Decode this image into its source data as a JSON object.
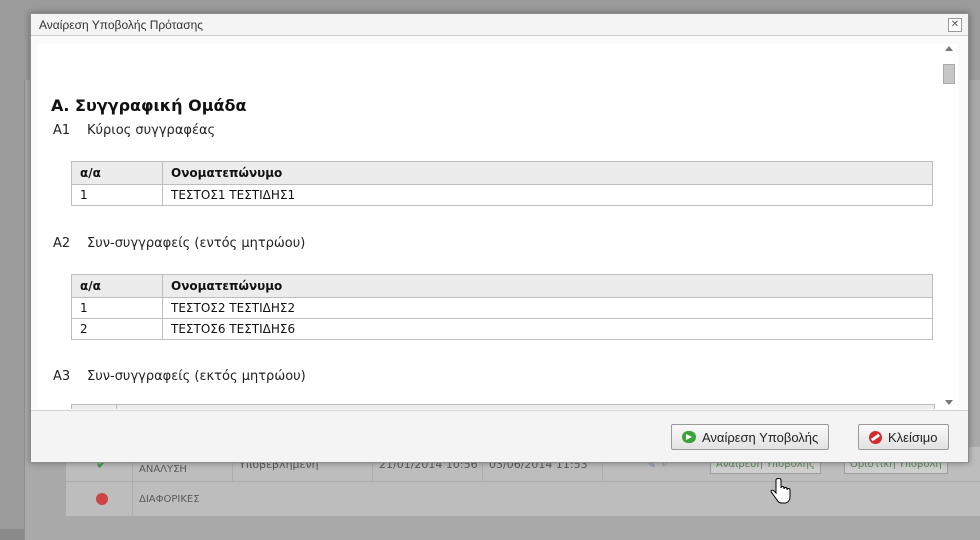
{
  "dialog": {
    "title": "Αναίρεση Υποβολής Πρότασης",
    "close_glyph": "✕"
  },
  "section": {
    "title": "Α. Συγγραφική Ομάδα",
    "a1": {
      "code": "Α1",
      "label": "Κύριος συγγραφέας"
    },
    "a2": {
      "code": "Α2",
      "label": "Συν-συγγραφείς (εντός μητρώου)"
    },
    "a3": {
      "code": "Α3",
      "label": "Συν-συγγραφείς (εκτός μητρώου)"
    }
  },
  "tables": {
    "headers": {
      "num": "α/α",
      "name": "Ονοματεπώνυμο"
    },
    "a1_rows": [
      {
        "num": "1",
        "name": "ΤΕΣΤΟΣ1 ΤΕΣΤΙΔΗΣ1"
      }
    ],
    "a2_rows": [
      {
        "num": "1",
        "name": "ΤΕΣΤΟΣ2 ΤΕΣΤΙΔΗΣ2"
      },
      {
        "num": "2",
        "name": "ΤΕΣΤΟΣ6 ΤΕΣΤΙΔΗΣ6"
      }
    ]
  },
  "footer": {
    "undo_label": "Αναίρεση Υποβολής",
    "close_label": "Κλείσιμο"
  },
  "background": {
    "row1": {
      "subject": "ΜΑΘΗΜΑΤΙΚΗ ΑΝΑΛΥΣΗ",
      "status": "Υποβεβλημένη",
      "date1": "21/01/2014 10:56",
      "date2": "03/06/2014 11:53",
      "undo_label": "Αναίρεση Υποβολής",
      "final_label": "Οριστική Υποβολή"
    },
    "row2": {
      "subject": "ΔΙΑΦΟΡΙΚΕΣ"
    }
  },
  "colors": {
    "accent_green": "#3aa33a",
    "close_red": "#d42a2a"
  }
}
